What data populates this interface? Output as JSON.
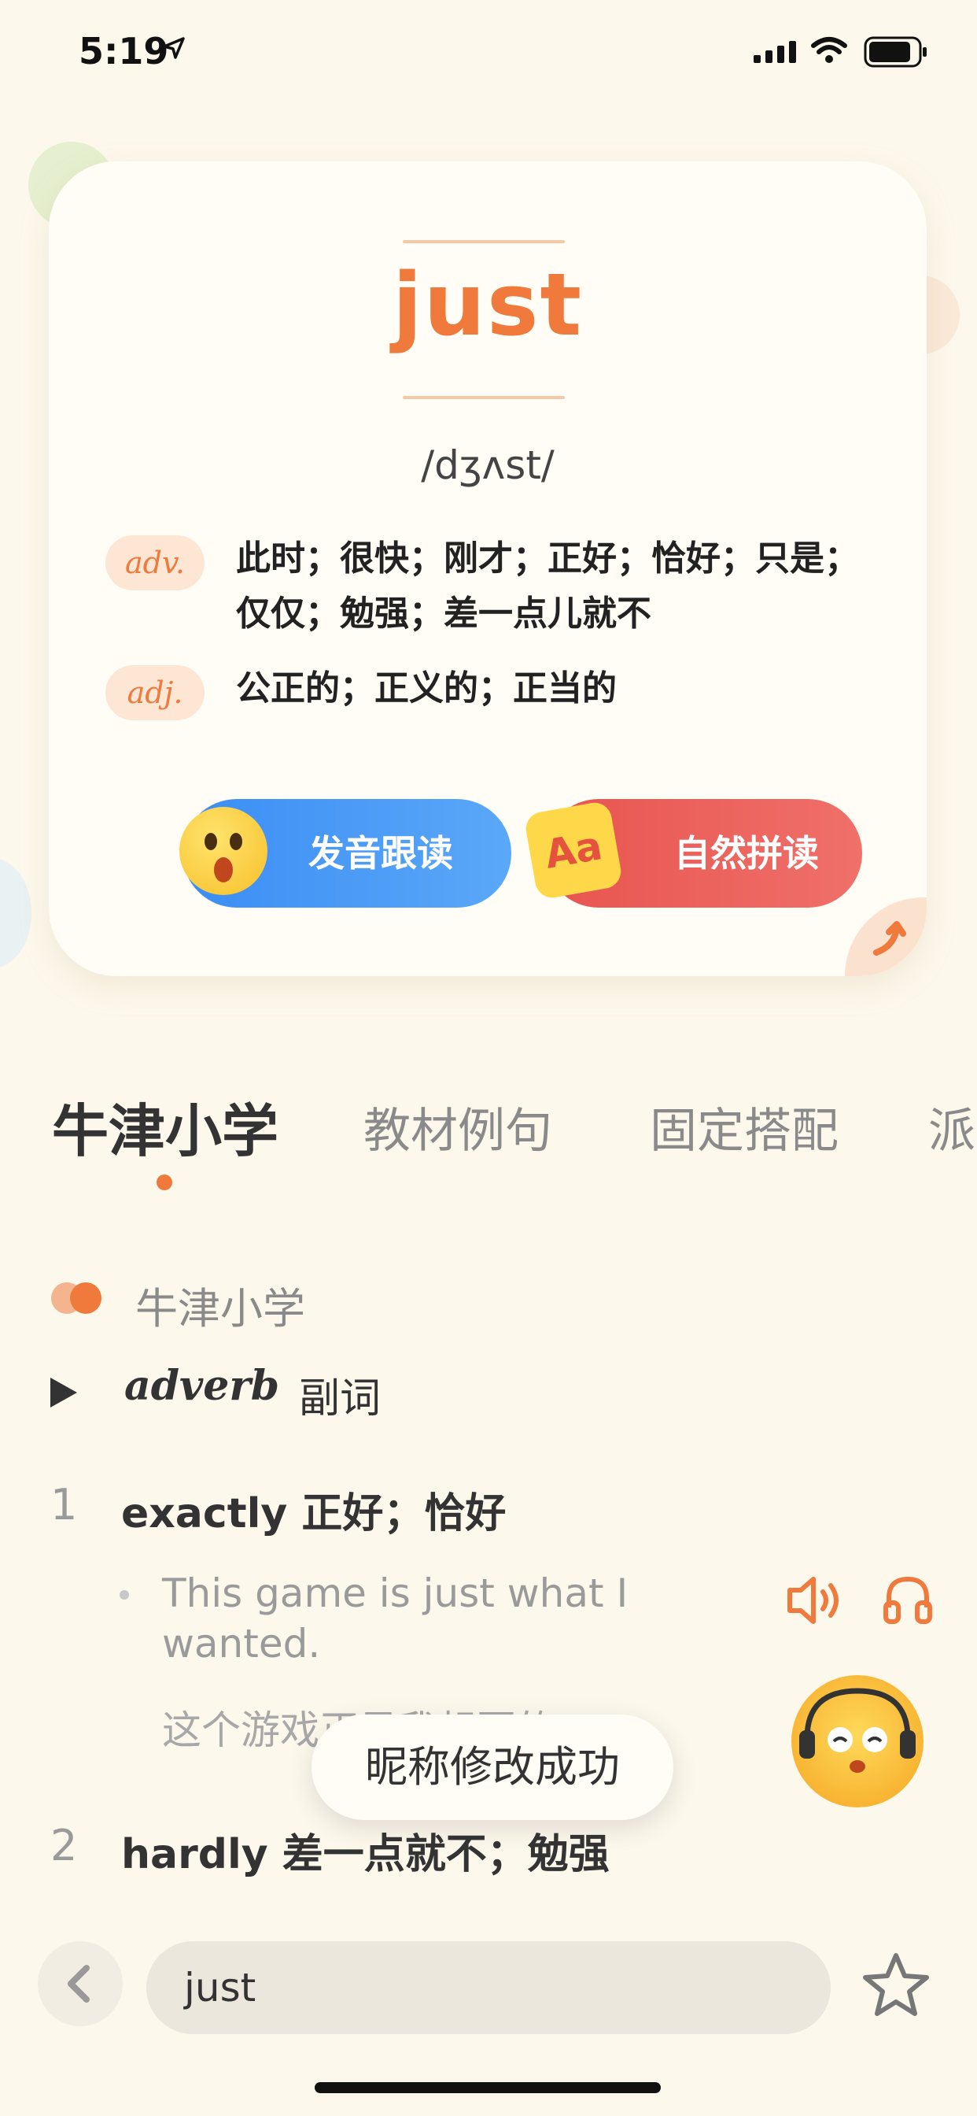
{
  "status_bar": {
    "time": "5:19"
  },
  "word_card": {
    "word": "just",
    "phonetic": "/dʒʌst/",
    "definitions": [
      {
        "pos": "adv.",
        "text": "此时；很快；刚才；正好；恰好；只是；仅仅；勉强；差一点儿就不"
      },
      {
        "pos": "adj.",
        "text": "公正的；正义的；正当的"
      }
    ],
    "buttons": {
      "pronunciation": "发音跟读",
      "phonics": "自然拼读",
      "aa_icon": "Aa"
    }
  },
  "tabs": [
    "牛津小学",
    "教材例句",
    "固定搭配",
    "派生"
  ],
  "active_tab": "牛津小学",
  "content": {
    "section_title": "牛津小学",
    "pos_en": "adverb",
    "pos_zh": "副词",
    "senses": [
      {
        "number": "1",
        "text": "exactly 正好；恰好",
        "example_en": "This game is just what I wanted.",
        "example_zh": "这个游戏正是我想要的"
      },
      {
        "number": "2",
        "text": "hardly 差一点就不；勉强"
      }
    ]
  },
  "toast": "昵称修改成功",
  "bottom_bar": {
    "search_value": "just"
  },
  "colors": {
    "accent": "#ef7a3c",
    "background": "#fdf8ec",
    "blue": "#3b8df5",
    "red": "#e8544f"
  }
}
